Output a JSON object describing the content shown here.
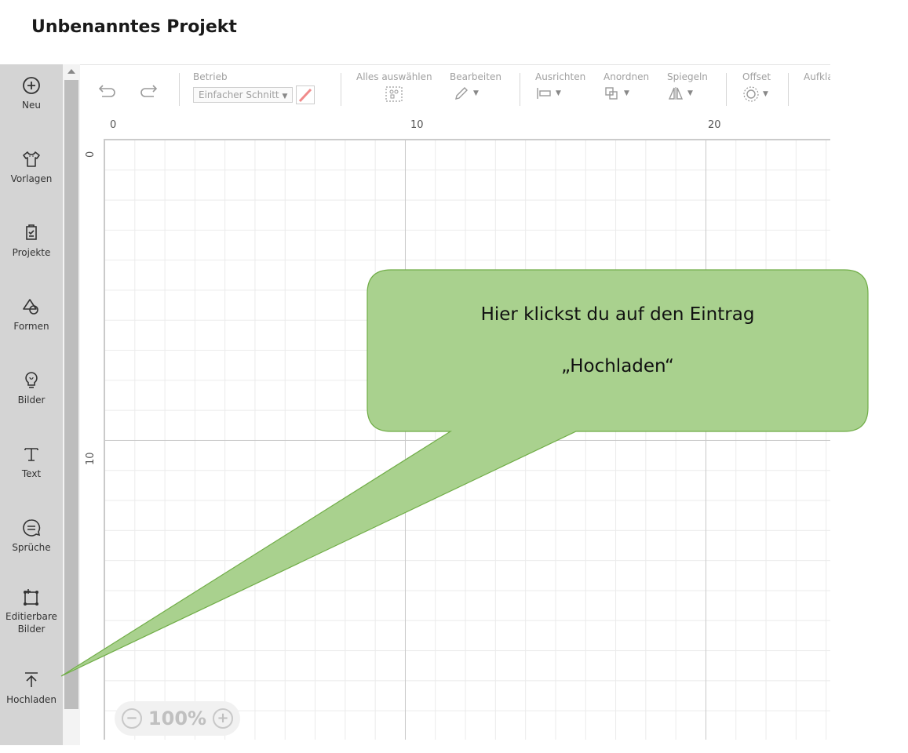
{
  "project_title": "Unbenanntes Projekt",
  "sidebar": {
    "items": [
      {
        "label": "Neu",
        "icon": "plus-circle-icon"
      },
      {
        "label": "Vorlagen",
        "icon": "tshirt-icon"
      },
      {
        "label": "Projekte",
        "icon": "project-clipboard-icon"
      },
      {
        "label": "Formen",
        "icon": "shapes-icon"
      },
      {
        "label": "Bilder",
        "icon": "lightbulb-icon"
      },
      {
        "label": "Text",
        "icon": "text-T-icon"
      },
      {
        "label": "Sprüche",
        "icon": "speech-bubble-icon"
      },
      {
        "label": "Editierbare\nBilder",
        "icon": "editable-image-icon"
      },
      {
        "label": "Hochladen",
        "icon": "upload-icon"
      }
    ]
  },
  "toolbar": {
    "undo_icon": "undo-icon",
    "redo_icon": "redo-icon",
    "operation_label": "Betrieb",
    "operation_value": "Einfacher Schnitt",
    "select_all_label": "Alles auswählen",
    "edit_label": "Bearbeiten",
    "align_label": "Ausrichten",
    "arrange_label": "Anordnen",
    "mirror_label": "Spiegeln",
    "offset_label": "Offset",
    "unfold_label": "Aufklappen"
  },
  "ruler": {
    "top": [
      "0",
      "10",
      "20"
    ],
    "left": [
      "0",
      "10"
    ]
  },
  "zoom": {
    "value": "100%"
  },
  "callout": {
    "line1": "Hier klickst du auf den Eintrag",
    "line2": "„Hochladen“"
  },
  "colors": {
    "sidebar_bg": "#d4d4d4",
    "callout_fill": "#a9d18e",
    "callout_stroke": "#70ad47",
    "pen_accent": "#f08a8a"
  }
}
